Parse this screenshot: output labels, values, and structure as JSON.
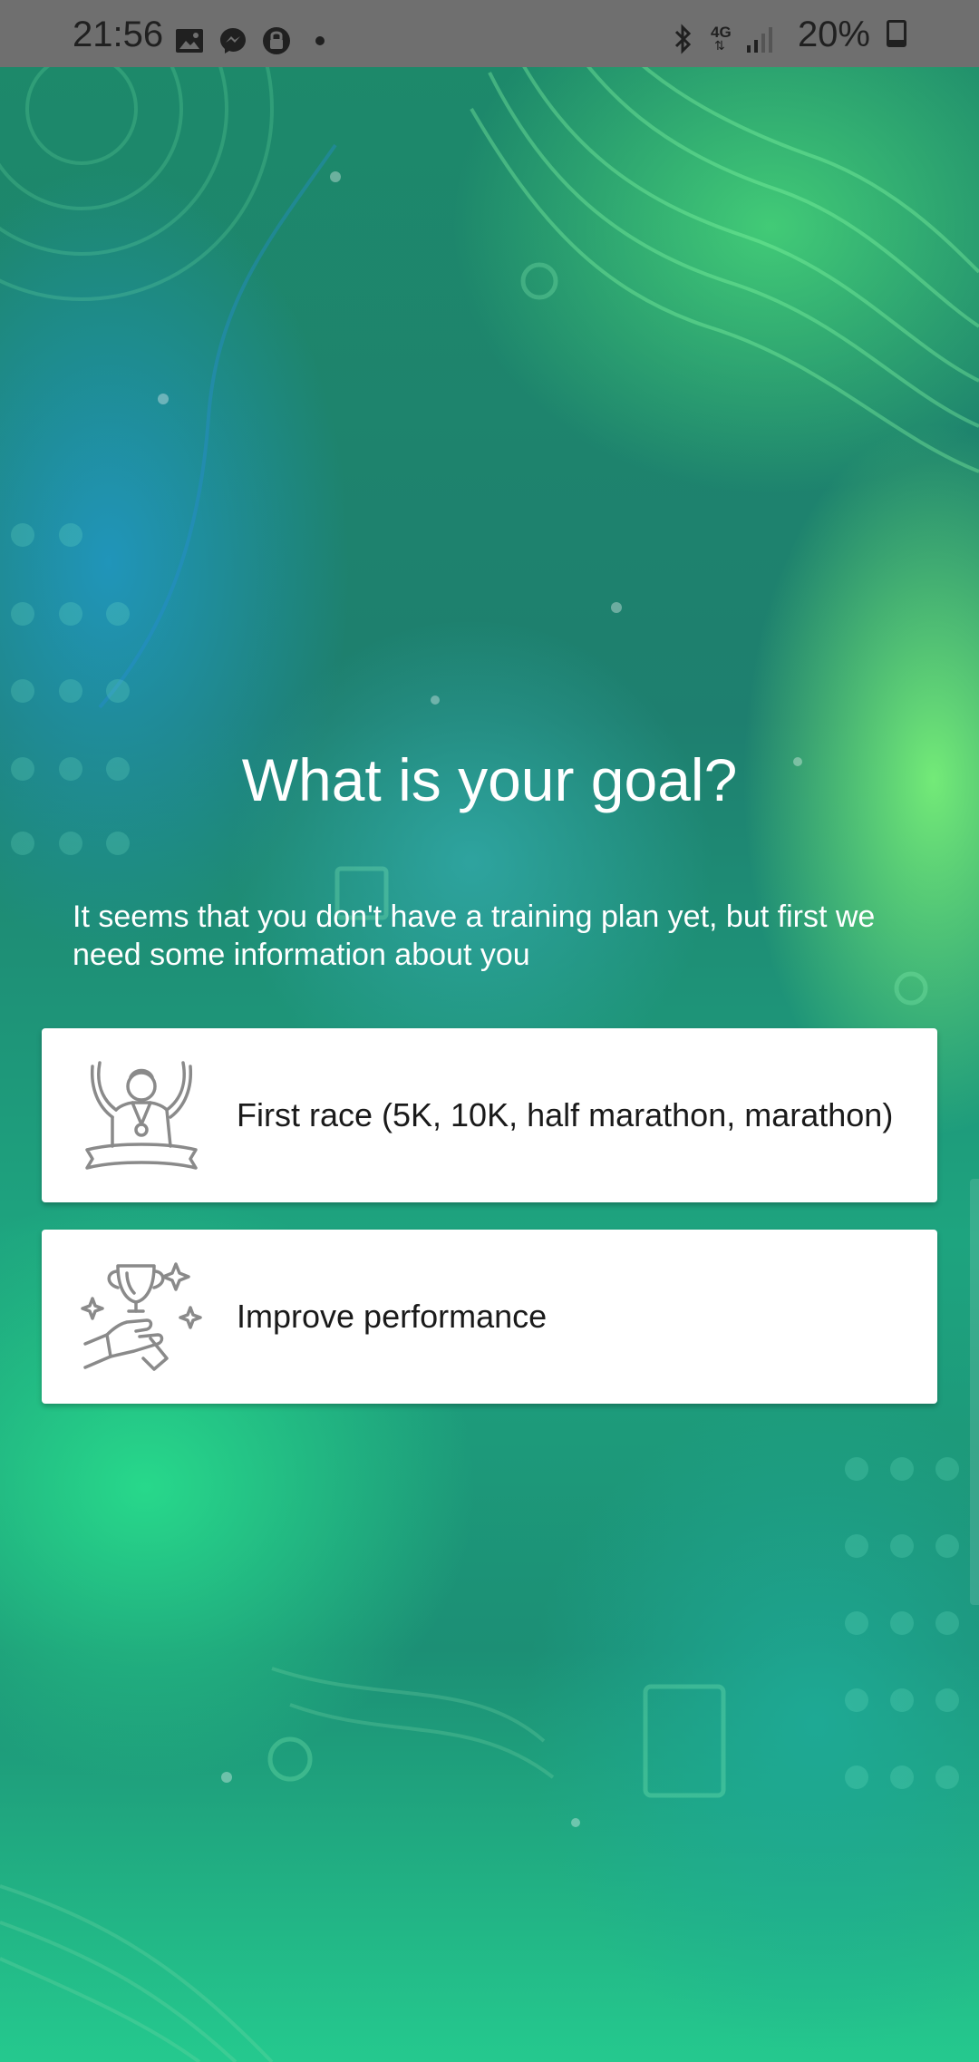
{
  "status_bar": {
    "time": "21:56",
    "network": "4G",
    "battery": "20%",
    "battery_level": 0.2,
    "left_icons": [
      "gallery-icon",
      "messenger-icon",
      "vpn-lock-icon",
      "dot-icon"
    ],
    "right_icons": [
      "bluetooth-icon",
      "network-4g-icon",
      "signal-icon",
      "battery-icon"
    ]
  },
  "page": {
    "title": "What is your goal?",
    "subtitle": "It seems that you don't have a training plan yet, but first we need some information about you"
  },
  "options": [
    {
      "label": "First race (5K, 10K, half marathon, marathon)",
      "icon": "runner-medal-icon"
    },
    {
      "label": "Improve performance",
      "icon": "trophy-hand-icon"
    }
  ],
  "colors": {
    "status_bar": "#6f6f6f",
    "card_background": "#ffffff",
    "text_on_background": "#ffffff",
    "card_text": "#1a1a1a",
    "icon_stroke": "#8a8a8a"
  }
}
